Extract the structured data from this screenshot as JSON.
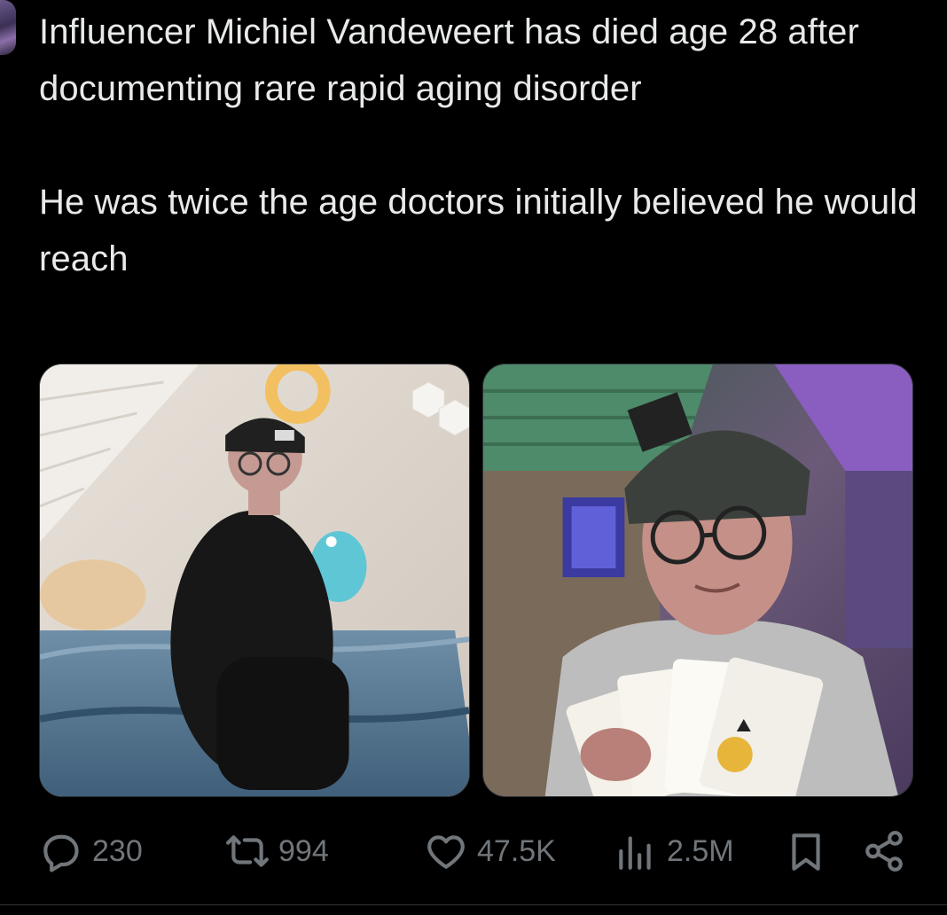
{
  "tweet": {
    "text_line1": "Influencer Michiel Vandeweert has died age 28 after documenting rare rapid aging disorder",
    "text_line2": "He was twice the age doctors initially believed he would reach"
  },
  "media": [
    {
      "alt_icon": "photo-bedroom"
    },
    {
      "alt_icon": "photo-cards"
    }
  ],
  "actions": {
    "replies": "230",
    "reposts": "994",
    "likes": "47.5K",
    "views": "2.5M"
  },
  "icons": {
    "reply": "reply-icon",
    "repost": "repost-icon",
    "like": "heart-icon",
    "views": "views-icon",
    "bookmark": "bookmark-icon",
    "share": "share-icon"
  },
  "colors": {
    "background": "#000000",
    "text": "#e7e9ea",
    "muted": "#71767b"
  }
}
